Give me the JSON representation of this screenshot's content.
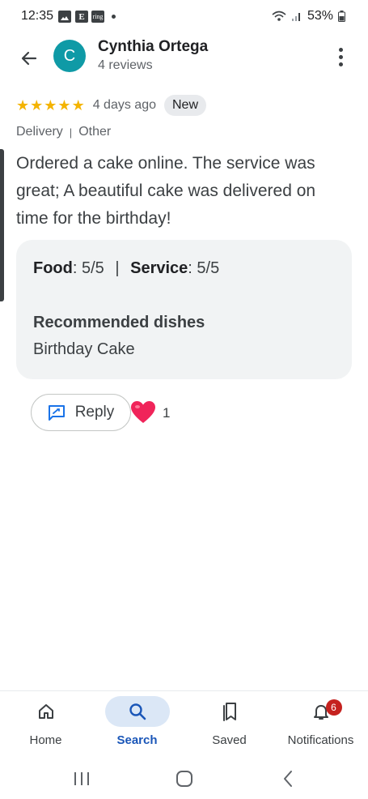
{
  "status_bar": {
    "time": "12:35",
    "icons": [
      "image-icon",
      "e-news-icon",
      "ring-app-icon",
      "dot-indicator"
    ],
    "ring_label": "ring",
    "e_label": "E",
    "battery": "53%"
  },
  "header": {
    "avatar_letter": "C",
    "avatar_color": "#0f9aa6",
    "reviewer_name": "Cynthia Ortega",
    "review_count": "4 reviews"
  },
  "review": {
    "stars": 5,
    "star_color": "#f4b400",
    "date": "4 days ago",
    "badge": "New",
    "tags": [
      "Delivery",
      "Other"
    ],
    "tag_separator": "|",
    "text": "Ordered a cake online. The service was great; A beautiful cake was delivered on time for the birthday!"
  },
  "ratings": {
    "food_label": "Food",
    "food_value": ": 5/5",
    "separator": "|",
    "service_label": "Service",
    "service_value": ": 5/5",
    "recommended_title": "Recommended dishes",
    "recommended_dish": "Birthday Cake"
  },
  "actions": {
    "reply_label": "Reply",
    "like_count": "1"
  },
  "bottom_nav": {
    "items": [
      {
        "label": "Home",
        "icon": "home-icon",
        "active": false
      },
      {
        "label": "Search",
        "icon": "search-icon",
        "active": true
      },
      {
        "label": "Saved",
        "icon": "saved-icon",
        "active": false
      },
      {
        "label": "Notifications",
        "icon": "bell-icon",
        "active": false,
        "badge": "6"
      }
    ],
    "active_color": "#1a56b8"
  },
  "system_nav": [
    "recents-icon",
    "home-circle-icon",
    "back-chevron-icon"
  ]
}
